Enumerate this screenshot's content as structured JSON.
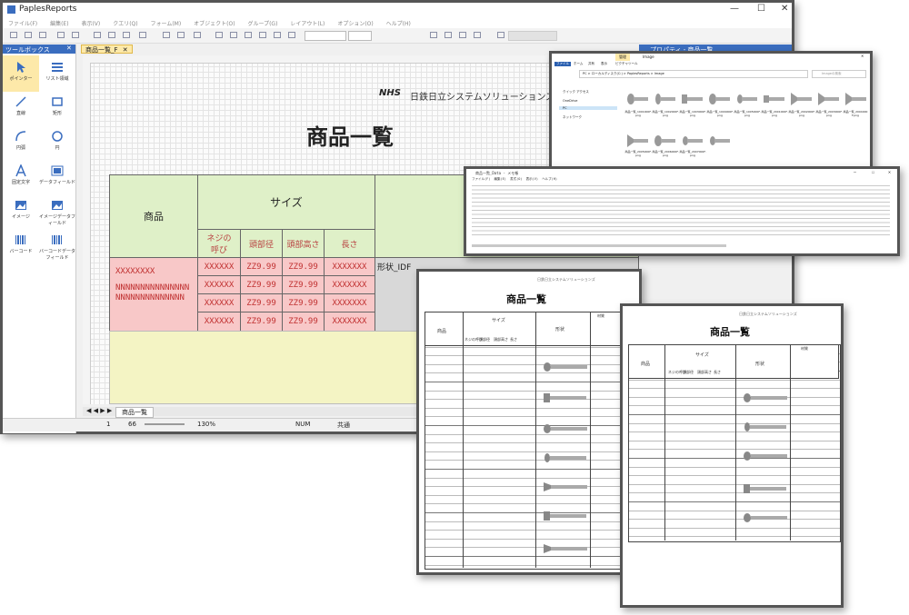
{
  "app": {
    "title": "PaplesReports",
    "menu": [
      "ファイル(F)",
      "編集(E)",
      "表示(V)",
      "クエリ(Q)",
      "フォーム(M)",
      "オブジェクト(O)",
      "グループ(G)",
      "レイアウト(L)",
      "オプション(O)",
      "ヘルプ(H)"
    ]
  },
  "toolbox": {
    "title": "ツールボックス",
    "items": [
      {
        "label": "ポインター",
        "icon": "pointer-icon"
      },
      {
        "label": "リスト領域",
        "icon": "list-area-icon"
      },
      {
        "label": "直線",
        "icon": "line-icon"
      },
      {
        "label": "矩形",
        "icon": "rectangle-icon"
      },
      {
        "label": "円弧",
        "icon": "arc-icon"
      },
      {
        "label": "円",
        "icon": "circle-icon"
      },
      {
        "label": "固定文字",
        "icon": "text-icon"
      },
      {
        "label": "データフィールド",
        "icon": "data-field-icon"
      },
      {
        "label": "イメージ",
        "icon": "image-icon"
      },
      {
        "label": "イメージデータフィールド",
        "icon": "image-data-field-icon"
      },
      {
        "label": "バーコード",
        "icon": "barcode-icon"
      },
      {
        "label": "バーコードデータフィールド",
        "icon": "barcode-data-field-icon"
      }
    ]
  },
  "editor": {
    "tab": "商品一覧_F",
    "sheet_tab": "商品一覧",
    "company": "日鉄日立システムソリューションズ",
    "title": "商品一覧",
    "headers": {
      "product": "商品",
      "size": "サイズ",
      "shape": "形状"
    },
    "sub_headers": [
      "ネジの呼び",
      "頭部径",
      "頭部高さ",
      "長さ"
    ],
    "product_code": "XXXXXXXX",
    "product_name": "NNNNNNNNNNNNNNNNNNNNNNNNNNNNN",
    "rows": [
      [
        "XXXXXX",
        "ZZ9.99",
        "ZZ9.99",
        "XXXXXXX"
      ],
      [
        "XXXXXX",
        "ZZ9.99",
        "ZZ9.99",
        "XXXXXXX"
      ],
      [
        "XXXXXX",
        "ZZ9.99",
        "ZZ9.99",
        "XXXXXXX"
      ],
      [
        "XXXXXX",
        "ZZ9.99",
        "ZZ9.99",
        "XXXXXXX"
      ]
    ],
    "shape_field": "形状_IDF"
  },
  "status": {
    "page": "1",
    "count": "66",
    "zoom": "130%",
    "num": "NUM",
    "mode": "共通"
  },
  "properties": {
    "title": "プロパティ - 商品一覧"
  },
  "explorer": {
    "tab_active": "管理",
    "tab_right": "Image",
    "tabs": [
      "ファイル",
      "ホーム",
      "共有",
      "表示",
      "ピクチャツール"
    ],
    "path": "PC > ローカルディスク(C:) > PaplesReports > Image",
    "search": "Imageの検索",
    "nav": [
      "クイック アクセス",
      "OneDrive",
      "PC",
      "ネットワーク"
    ],
    "files": [
      "商品一覧_1001000F.png",
      "商品一覧_1002000F.png",
      "商品一覧_1003000F.png",
      "商品一覧_1004000F.png",
      "商品一覧_1005000F.png",
      "商品一覧_2001000F.png",
      "商品一覧_2002000F.png",
      "商品一覧_2003000F.png",
      "商品一覧_2004000F.png",
      "商品一覧_2005000F.png",
      "商品一覧_2006000F.png",
      "商品一覧_2007000F.png"
    ]
  },
  "csv": {
    "title": "商品一覧_Data - メモ帳",
    "menu": [
      "ファイル(F)",
      "編集(E)",
      "書式(O)",
      "表示(V)",
      "ヘルプ(H)"
    ]
  },
  "report_page": {
    "title": "商品一覧",
    "company": "日鉄日立システムソリューションズ",
    "headers": {
      "product": "商品",
      "size": "サイズ",
      "shape": "形状",
      "material": "材質"
    },
    "sub_headers": [
      "ネジの呼び",
      "頭部径",
      "頭部高さ",
      "長さ"
    ]
  }
}
